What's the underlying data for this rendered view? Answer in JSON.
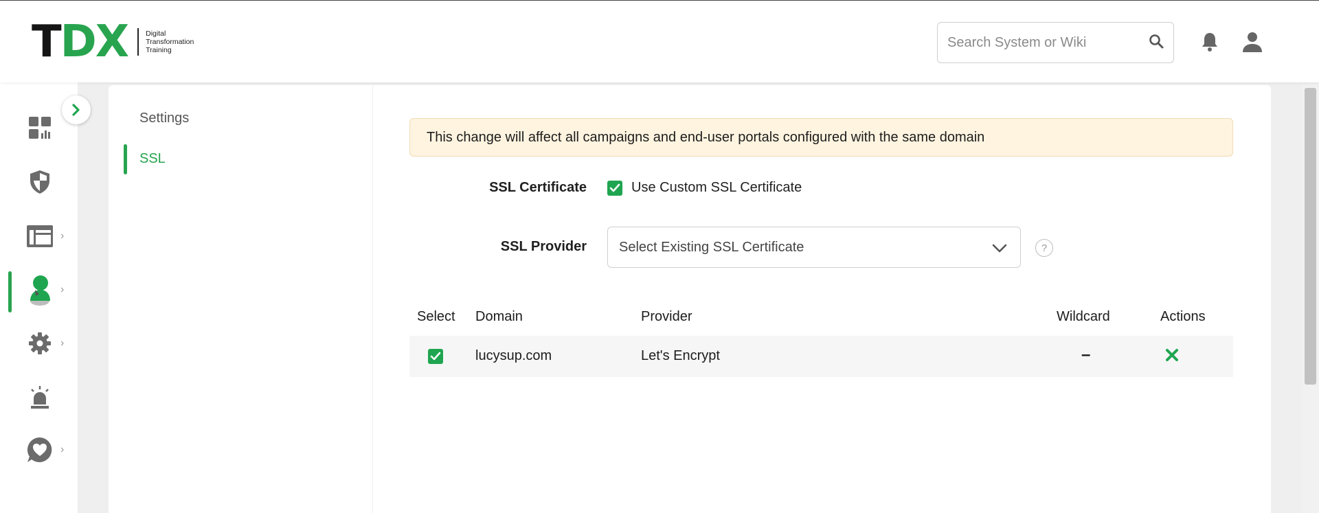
{
  "header": {
    "logo_t": "T",
    "logo_dx": "DX",
    "logo_sub": [
      "Digital",
      "Transformation",
      "Training"
    ],
    "search_placeholder": "Search System or Wiki"
  },
  "rail": {
    "items": [
      {
        "icon": "dashboard-icon",
        "has_chevron": false
      },
      {
        "icon": "shield-icon",
        "has_chevron": false
      },
      {
        "icon": "layout-icon",
        "has_chevron": true
      },
      {
        "icon": "user-phishing-icon",
        "has_chevron": true,
        "active": true
      },
      {
        "icon": "gear-icon",
        "has_chevron": true
      },
      {
        "icon": "alarm-icon",
        "has_chevron": false
      },
      {
        "icon": "heart-chat-icon",
        "has_chevron": true
      }
    ],
    "chevron": "›"
  },
  "subnav": {
    "title": "Settings",
    "item": "SSL"
  },
  "main": {
    "alert": "This change will affect all campaigns and end-user portals configured with the same domain",
    "ssl_certificate_label": "SSL Certificate",
    "use_custom_label": "Use Custom SSL Certificate",
    "ssl_provider_label": "SSL Provider",
    "ssl_provider_value": "Select Existing SSL Certificate",
    "help": "?",
    "table": {
      "headers": [
        "Select",
        "Domain",
        "Provider",
        "Wildcard",
        "Actions"
      ],
      "rows": [
        {
          "domain": "lucysup.com",
          "provider": "Let's Encrypt",
          "wildcard": "–"
        }
      ]
    }
  },
  "colors": {
    "accent": "#28a44f",
    "alert_bg": "#fff4e0"
  }
}
